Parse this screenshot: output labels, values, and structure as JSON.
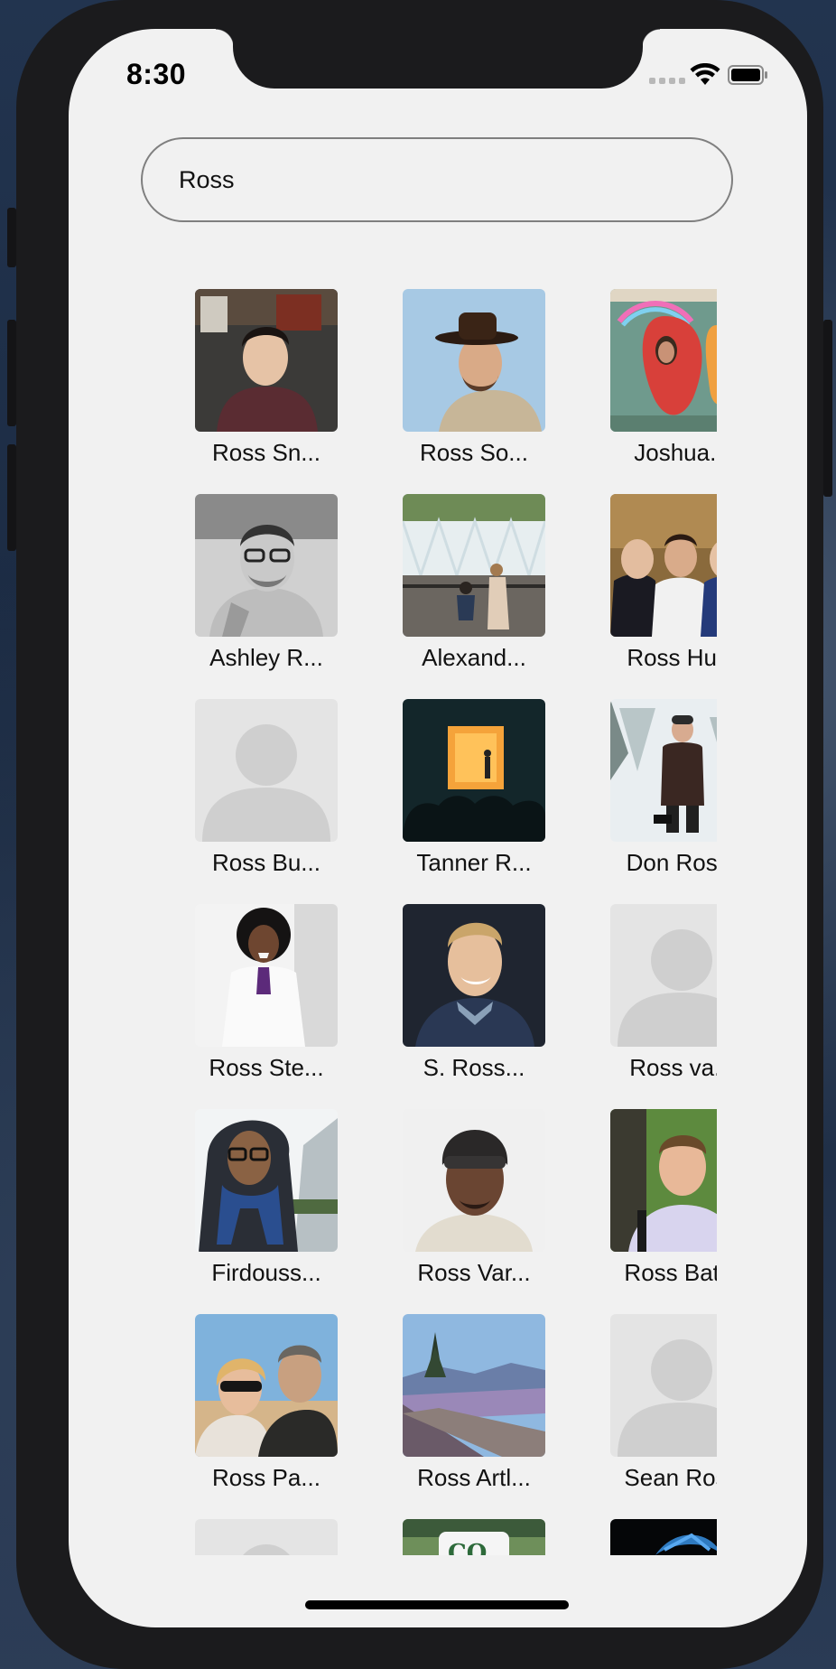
{
  "status_bar": {
    "time": "8:30"
  },
  "search": {
    "value": "Ross"
  },
  "results": [
    {
      "name": "Ross Sn...",
      "photo": "photo-man-dark-hair-bar"
    },
    {
      "name": "Ross So...",
      "photo": "photo-man-hat-blue-sky"
    },
    {
      "name": "Joshua...",
      "photo": "photo-strawberry-mural"
    },
    {
      "name": "Ashley R...",
      "photo": "photo-man-glasses-bw"
    },
    {
      "name": "Alexand...",
      "photo": "photo-waterfall-proposal"
    },
    {
      "name": "Ross Hu...",
      "photo": "photo-three-men-suits"
    },
    {
      "name": "Ross Bu...",
      "photo": "default-avatar"
    },
    {
      "name": "Tanner R...",
      "photo": "photo-concert-stage"
    },
    {
      "name": "Don Ros...",
      "photo": "photo-man-snow-forest"
    },
    {
      "name": "Ross Ste...",
      "photo": "photo-man-afro-white-suit"
    },
    {
      "name": "S. Ross...",
      "photo": "photo-man-portrait-dark"
    },
    {
      "name": "Ross  va...",
      "photo": "default-avatar"
    },
    {
      "name": "Firdouss...",
      "photo": "photo-man-hood-scarf-snow"
    },
    {
      "name": "Ross Var...",
      "photo": "photo-man-beanie"
    },
    {
      "name": "Ross Bat...",
      "photo": "photo-man-outdoors-backpack"
    },
    {
      "name": "Ross Pa...",
      "photo": "photo-couple-beach"
    },
    {
      "name": "Ross Artl...",
      "photo": "photo-mountain-rocks"
    },
    {
      "name": "Sean Ross",
      "photo": "default-avatar"
    },
    {
      "name": "",
      "photo": "default-avatar"
    },
    {
      "name": "",
      "photo": "photo-coffee-mug"
    },
    {
      "name": "",
      "photo": "photo-dark-blue-logo"
    }
  ],
  "colors": {
    "screen_bg": "#f1f1f1",
    "search_border": "#7f7f7f",
    "placeholder_avatar_bg": "#e4e4e4",
    "placeholder_avatar_fg": "#cfcfcf"
  }
}
